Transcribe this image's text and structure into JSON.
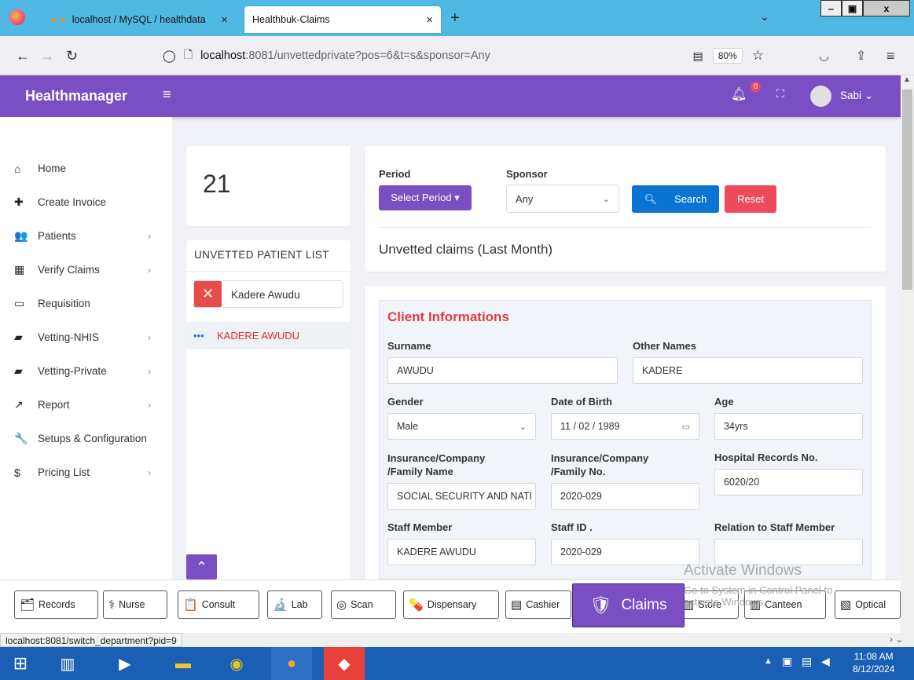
{
  "browser": {
    "tabs": [
      {
        "label": "localhost / MySQL / healthdata"
      },
      {
        "label": "Healthbuk-Claims"
      }
    ],
    "url_host": "localhost",
    "url_rest": ":8081/unvettedprivate?pos=6&t=s&sponsor=Any",
    "zoom": "80%",
    "status_url": "localhost:8081/switch_department?pid=9"
  },
  "header": {
    "brand": "Healthmanager",
    "notification_count": "0",
    "user": "Sabi"
  },
  "sidebar": {
    "items": [
      {
        "label": "Home",
        "icon": "home-icon",
        "glyph": "⌂"
      },
      {
        "label": "Create Invoice",
        "icon": "plus-icon",
        "glyph": "✚"
      },
      {
        "label": "Patients",
        "icon": "users-icon",
        "glyph": "👥"
      },
      {
        "label": "Verify Claims",
        "icon": "qrcode-icon",
        "glyph": "▦"
      },
      {
        "label": "Requisition",
        "icon": "calendar-icon",
        "glyph": "▭"
      },
      {
        "label": "Vetting-NHIS",
        "icon": "folder-open-icon",
        "glyph": "▰"
      },
      {
        "label": "Vetting-Private",
        "icon": "folder-open-icon",
        "glyph": "▰"
      },
      {
        "label": "Report",
        "icon": "line-chart-icon",
        "glyph": "↗"
      },
      {
        "label": "Setups & Configuration",
        "icon": "wrench-icon",
        "glyph": "🔧"
      },
      {
        "label": "Pricing List",
        "icon": "dollar-icon",
        "glyph": "$"
      }
    ]
  },
  "left_panel": {
    "count": "21",
    "list_title": "UNVETTED PATIENT LIST",
    "search_value": "Kadere Awudu",
    "patients": [
      {
        "name": "KADERE AWUDU"
      }
    ]
  },
  "filter": {
    "period_label": "Period",
    "period_button": "Select Period ▾",
    "sponsor_label": "Sponsor",
    "sponsor_value": "Any",
    "search_button": "Search",
    "reset_button": "Reset",
    "heading": "Unvetted claims (Last Month)"
  },
  "client": {
    "title": "Client Informations",
    "surname_label": "Surname",
    "surname": "AWUDU",
    "other_names_label": "Other Names",
    "other_names": "KADERE",
    "gender_label": "Gender",
    "gender": "Male",
    "dob_label": "Date of Birth",
    "dob": "11 / 02 / 1989",
    "age_label": "Age",
    "age": "34yrs",
    "ins_name_label_1": "Insurance/Company",
    "ins_name_label_2": "/Family Name",
    "ins_name": "SOCIAL SECURITY AND NATI",
    "ins_no_label_1": "Insurance/Company",
    "ins_no_label_2": "/Family No.",
    "ins_no": "2020-029",
    "records_label": "Hospital Records No.",
    "records_no": "6020/20",
    "staff_label": "Staff Member",
    "staff": "KADERE AWUDU",
    "staff_id_label": "Staff ID .",
    "staff_id": "2020-029",
    "relation_label": "Relation to Staff Member",
    "relation": ""
  },
  "departments": [
    {
      "label": "Records",
      "icon": "records-icon",
      "glyph": "🗂"
    },
    {
      "label": "Nurse",
      "icon": "nurse-icon",
      "glyph": "⚕"
    },
    {
      "label": "Consult",
      "icon": "consult-icon",
      "glyph": "📋"
    },
    {
      "label": "Lab",
      "icon": "microscope-icon",
      "glyph": "🔬"
    },
    {
      "label": "Scan",
      "icon": "scan-icon",
      "glyph": "◎"
    },
    {
      "label": "Dispensary",
      "icon": "pill-icon",
      "glyph": "💊"
    },
    {
      "label": "Cashier",
      "icon": "cashier-icon",
      "glyph": "▤"
    },
    {
      "label": "Claims",
      "icon": "claims-icon",
      "glyph": "🛡"
    },
    {
      "label": "Store",
      "icon": "store-icon",
      "glyph": "▥"
    },
    {
      "label": "Canteen",
      "icon": "canteen-icon",
      "glyph": "▥"
    },
    {
      "label": "Optical",
      "icon": "optical-icon",
      "glyph": "▧"
    }
  ],
  "watermark": {
    "line1": "Activate Windows",
    "line2": "Go to System in Control Panel to",
    "line3": "activate Windows."
  },
  "taskbar": {
    "time": "11:08 AM",
    "date": "8/12/2024"
  },
  "colors": {
    "primary": "#7a4fc3",
    "search": "#0a74d5",
    "reset": "#ef4a5b",
    "danger_text": "#e53d3d",
    "tabbar": "#4fb9e3"
  }
}
